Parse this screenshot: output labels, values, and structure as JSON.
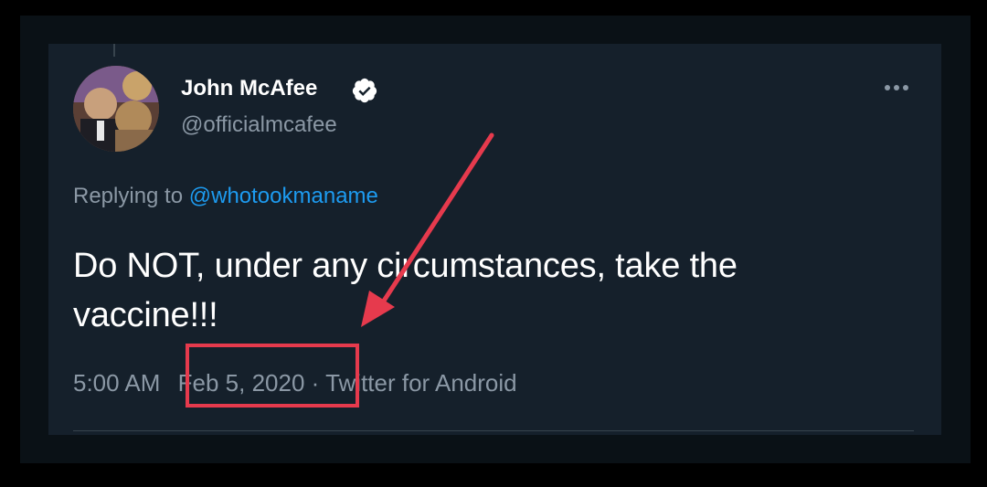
{
  "tweet": {
    "author": {
      "display_name": "John McAfee",
      "handle": "@officialmcafee",
      "verified": true
    },
    "reply": {
      "prefix": "Replying to ",
      "mention": "@whotookmaname"
    },
    "text_line1": "Do NOT, under any circumstances, take the",
    "text_line2": "vaccine!!!",
    "time": "5:00 AM",
    "separator": " · ",
    "date": "Feb 5, 2020",
    "source": "Twitter for Android"
  },
  "icons": {
    "verified": "verified-badge-icon",
    "more": "more-options-icon"
  },
  "colors": {
    "background": "#15202b",
    "text_primary": "#ffffff",
    "text_secondary": "#8b98a5",
    "link": "#1d9bf0",
    "annotation": "#e63a4d"
  }
}
